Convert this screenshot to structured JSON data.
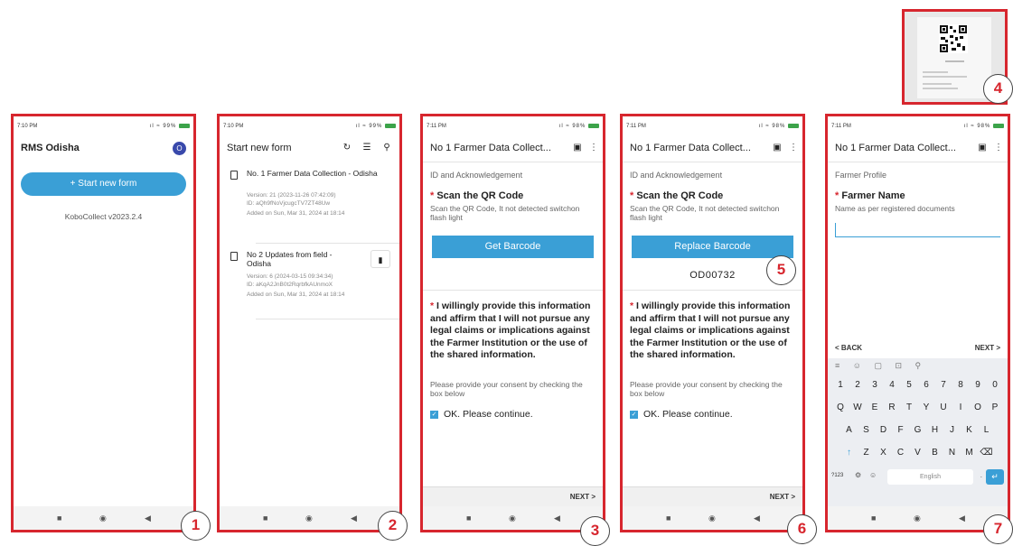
{
  "screen1": {
    "time": "7:10 PM",
    "status_right": "ıl ≈ 99%",
    "title": "RMS Odisha",
    "avatar_letter": "O",
    "start_button": "+   Start new form",
    "version": "KoboCollect v2023.2.4",
    "badge": "1"
  },
  "screen2": {
    "time": "7:10 PM",
    "status_right": "ıl ≈ 99%",
    "title": "Start new form",
    "forms": [
      {
        "name": "No. 1 Farmer Data Collection - Odisha",
        "version": "Version: 21 (2023-11-26 07:42:09)",
        "id": "ID: aQh9fNoVjcugcTV7ZT48Uw",
        "added": "Added on Sun, Mar 31, 2024 at 18:14"
      },
      {
        "name": "No 2 Updates from field - Odisha",
        "version": "Version: 6 (2024-03-15 09:34:34)",
        "id": "ID: aKqA2JnB0t2RqrbfkAUnmoX",
        "added": "Added on Sun, Mar 31, 2024 at 18:14"
      }
    ],
    "badge": "2"
  },
  "screen3": {
    "time": "7:11 PM",
    "status_right": "ıl ≈ 98%",
    "title": "No  1 Farmer Data Collect...",
    "section": "ID and Acknowledgement",
    "question": "Scan the QR Code",
    "hint": "Scan the QR Code, It not detected switchon flash light",
    "button": "Get Barcode",
    "consent": "I willingly provide this information and affirm that I will not pursue any legal claims or implications against the Farmer Institution or the use of the shared information.",
    "consent_hint": "Please provide your consent by checking the box below",
    "checkbox": "OK. Please continue.",
    "next": "NEXT >",
    "badge": "3"
  },
  "screen4": {
    "time": "7:11 PM",
    "status_right": "ıl ≈ 98%",
    "title": "No  1 Farmer Data Collect...",
    "section": "ID and Acknowledgement",
    "question": "Scan the QR Code",
    "hint": "Scan the QR Code, It not detected switchon flash light",
    "button": "Replace Barcode",
    "barcode_value": "OD00732",
    "consent": "I willingly provide this information and affirm that I will not pursue any legal claims or implications against the Farmer Institution or the use of the shared information.",
    "consent_hint": "Please provide your consent by checking the box below",
    "checkbox": "OK. Please continue.",
    "next": "NEXT >",
    "badge_value": "5",
    "badge": "6"
  },
  "screen5": {
    "time": "7:11 PM",
    "status_right": "ıl ≈ 98%",
    "title": "No  1 Farmer Data Collect...",
    "section": "Farmer Profile",
    "question": "Farmer Name",
    "hint": "Name as per registered documents",
    "back": "< BACK",
    "next": "NEXT >",
    "keyboard": {
      "numbers": [
        "1",
        "2",
        "3",
        "4",
        "5",
        "6",
        "7",
        "8",
        "9",
        "0"
      ],
      "row1": [
        "Q",
        "W",
        "E",
        "R",
        "T",
        "Y",
        "U",
        "I",
        "O",
        "P"
      ],
      "row2": [
        "A",
        "S",
        "D",
        "F",
        "G",
        "H",
        "J",
        "K",
        "L"
      ],
      "row3": [
        "Z",
        "X",
        "C",
        "V",
        "B",
        "N",
        "M"
      ],
      "symbols_key": "?123",
      "space_label": "English"
    },
    "badge": "7"
  },
  "qr_image": {
    "badge": "4"
  }
}
